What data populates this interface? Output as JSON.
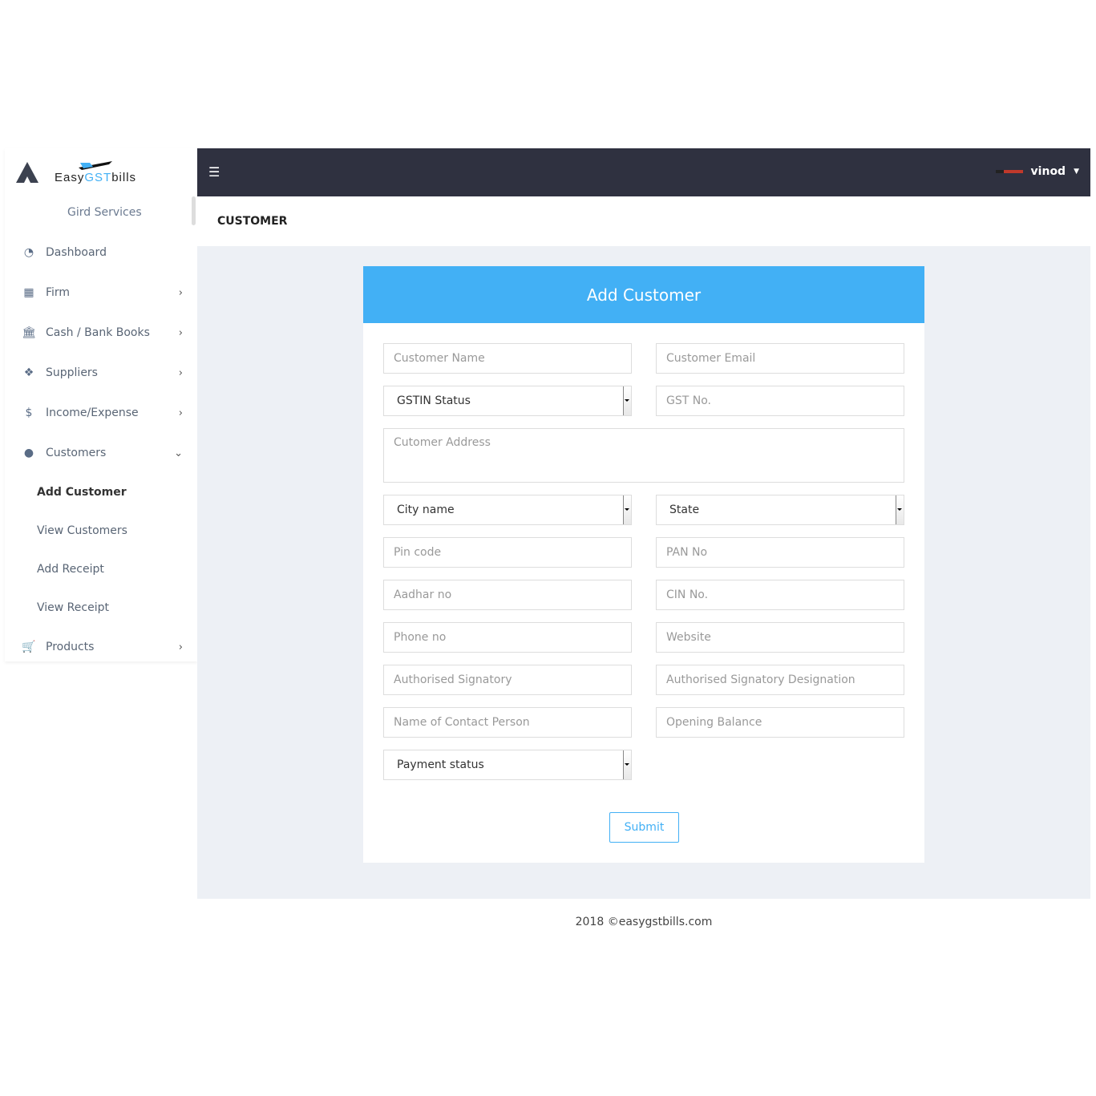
{
  "brand": {
    "easy": "Easy",
    "gst": "GST",
    "bills": "bills",
    "subtitle": "Gird Services"
  },
  "sidebar": {
    "items": [
      {
        "label": "Dashboard",
        "icon": "dashboard-icon"
      },
      {
        "label": "Firm",
        "icon": "building-icon"
      },
      {
        "label": "Cash / Bank Books",
        "icon": "bank-icon"
      },
      {
        "label": "Suppliers",
        "icon": "dropbox-icon"
      },
      {
        "label": "Income/Expense",
        "icon": "dollar-icon"
      },
      {
        "label": "Customers",
        "icon": "user-icon"
      },
      {
        "label": "Products",
        "icon": "cart-icon"
      }
    ],
    "customers_sub": [
      "Add Customer",
      "View Customers",
      "Add Receipt",
      "View Receipt"
    ]
  },
  "topbar": {
    "user": "vinod"
  },
  "page": {
    "title": "CUSTOMER"
  },
  "form": {
    "title": "Add Customer",
    "customer_name": "Customer Name",
    "customer_email": "Customer Email",
    "gstin_status": "GSTIN Status",
    "gst_no": "GST No.",
    "address": "Cutomer Address",
    "city": "City name",
    "state": "State",
    "pin": "Pin code",
    "pan": "PAN No",
    "aadhar": "Aadhar no",
    "cin": "CIN No.",
    "phone": "Phone no",
    "website": "Website",
    "signatory": "Authorised Signatory",
    "designation": "Authorised Signatory Designation",
    "contact": "Name of Contact Person",
    "opening": "Opening Balance",
    "payment": "Payment status",
    "submit": "Submit"
  },
  "footer": "2018 ©easygstbills.com",
  "colors": {
    "accent": "#42b0f5",
    "topbar": "#2f3140",
    "content_bg": "#edf0f5"
  }
}
